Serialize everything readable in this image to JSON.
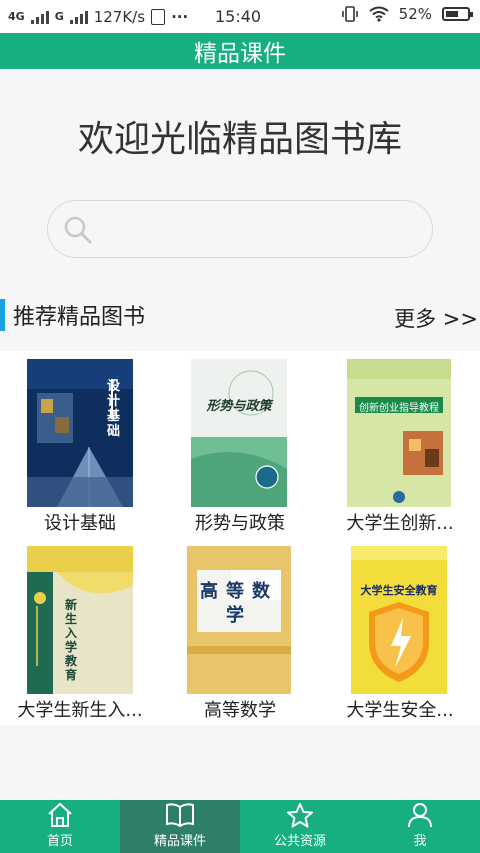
{
  "status_bar": {
    "net1": "4G",
    "net2": "G",
    "speed": "127K/s",
    "more": "···",
    "time": "15:40",
    "battery": "52%"
  },
  "app_bar": {
    "title": "精品课件"
  },
  "welcome": "欢迎光临精品图书库",
  "search": {
    "placeholder": "",
    "icon": "search-icon"
  },
  "section": {
    "title": "推荐精品图书",
    "more": "更多 >>",
    "accent_color": "#1aa1e0"
  },
  "books": [
    {
      "title": "设计基础",
      "cover_text": "设计基础"
    },
    {
      "title": "形势与政策",
      "cover_text": "形势与政策"
    },
    {
      "title": "大学生创新...",
      "cover_text": "创新创业指导教程"
    },
    {
      "title": "大学生新生入...",
      "cover_text": "新生入学教育"
    },
    {
      "title": "高等数学",
      "cover_text": "高等数学"
    },
    {
      "title": "大学生安全...",
      "cover_text": "大学生安全教育"
    }
  ],
  "tabs": [
    {
      "label": "首页",
      "icon": "home-icon"
    },
    {
      "label": "精品课件",
      "icon": "book-icon",
      "active": true
    },
    {
      "label": "公共资源",
      "icon": "star-icon"
    },
    {
      "label": "我",
      "icon": "person-icon"
    }
  ],
  "colors": {
    "brand": "#17ae82",
    "tab_active": "#2d7f68"
  }
}
